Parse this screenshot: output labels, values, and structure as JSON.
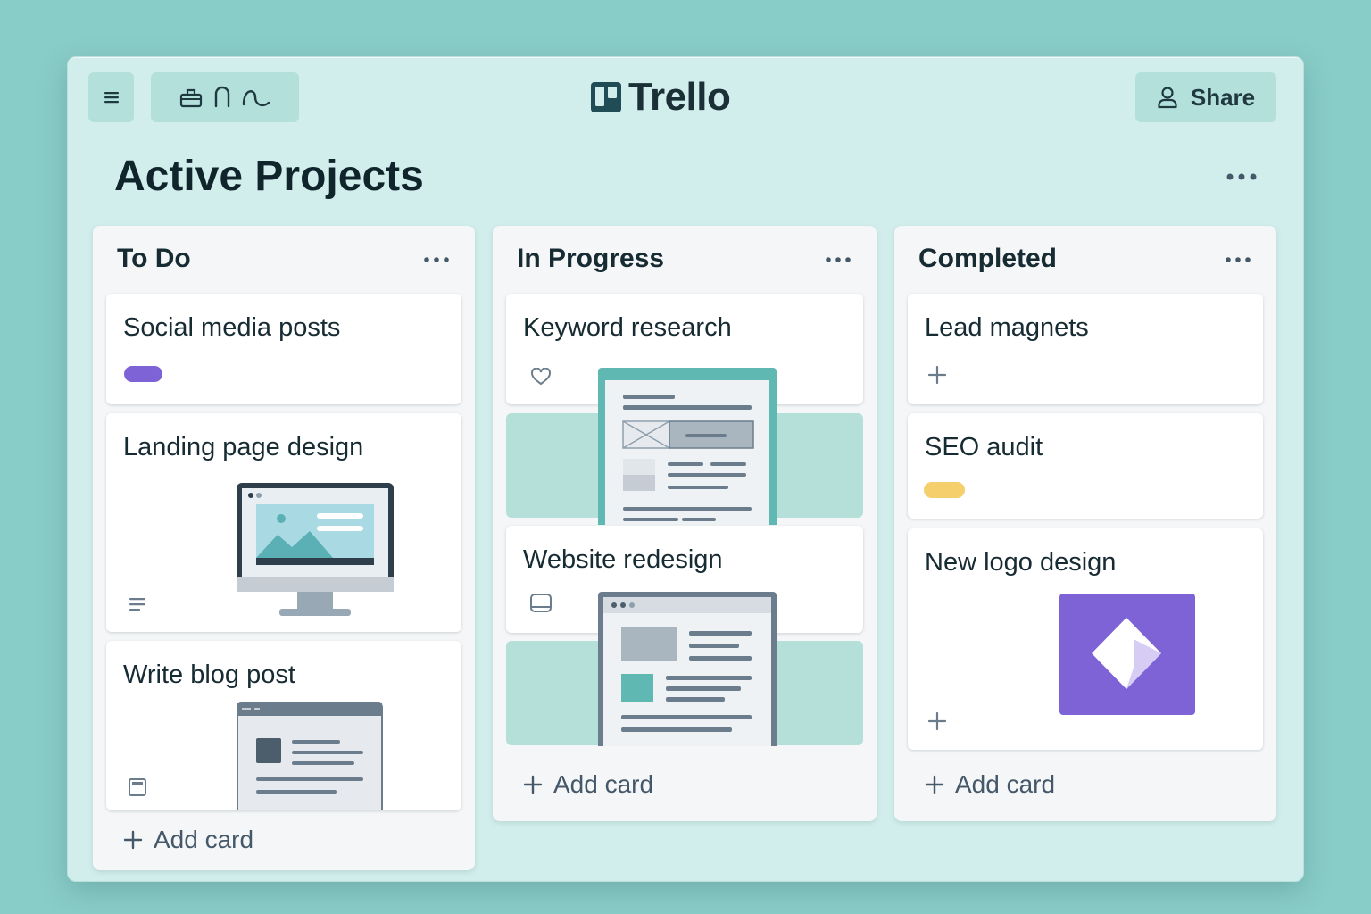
{
  "app": {
    "name": "Trello"
  },
  "header": {
    "share_label": "Share"
  },
  "board": {
    "title": "Active Projects"
  },
  "lists": [
    {
      "title": "To Do",
      "cards": [
        {
          "title": "Social media posts",
          "label_color": "#7e63d6"
        },
        {
          "title": "Landing page design"
        },
        {
          "title": "Write blog post"
        }
      ],
      "add_label": "Add card"
    },
    {
      "title": "In Progress",
      "cards": [
        {
          "title": "Keyword research"
        },
        {
          "title": "Website redesign"
        }
      ],
      "add_label": "Add card"
    },
    {
      "title": "Completed",
      "cards": [
        {
          "title": "Lead magnets"
        },
        {
          "title": "SEO audit",
          "label_color": "#f5cf6b"
        },
        {
          "title": "New logo design"
        }
      ],
      "add_label": "Add card"
    }
  ],
  "icons": {
    "menu": "hamburger-icon",
    "tools": [
      "briefcase-icon",
      "magnet-icon",
      "squiggle-icon"
    ],
    "share": "user-icon",
    "more": "ellipsis-icon",
    "add": "plus-icon"
  },
  "colors": {
    "background": "#89cdc8",
    "window": "#d2eeec",
    "accent_teal": "#5fb8b2",
    "purple": "#7e63d6",
    "yellow": "#f5cf6b"
  }
}
